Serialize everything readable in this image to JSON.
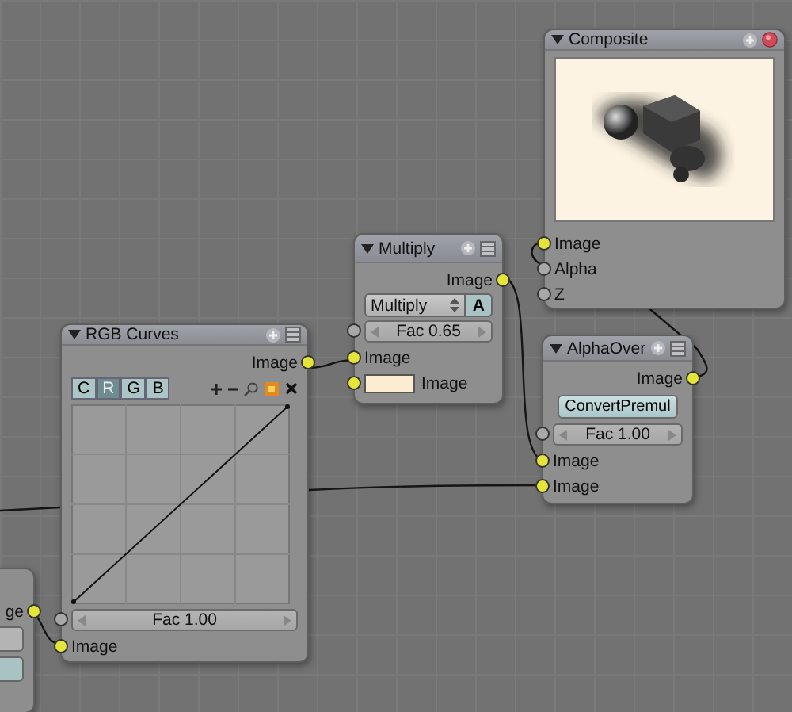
{
  "nodes": [
    {
      "kind": "full",
      "title": "Composite",
      "expanded": true,
      "closable": true,
      "widgets": [
        {
          "kind": "preview"
        }
      ],
      "inputs": [
        {
          "kind": "socket",
          "label": "Image",
          "color": "#e4e43a"
        },
        {
          "kind": "socket",
          "label": "Alpha",
          "color": "#a8a8a8"
        },
        {
          "kind": "socket",
          "label": "Z",
          "color": "#a8a8a8"
        }
      ]
    },
    {
      "kind": "full",
      "title": "Multiply",
      "expanded": true,
      "closable": false,
      "outputs": [
        {
          "kind": "socket",
          "label": "Image",
          "color": "#e4e43a"
        }
      ],
      "widgets": [
        {
          "kind": "dropdown",
          "value": "Multiply",
          "toggle": "A"
        }
      ],
      "inputs": [
        {
          "kind": "value",
          "label": "Fac 0.65",
          "color": "#a8a8a8"
        },
        {
          "kind": "socket",
          "label": "Image",
          "color": "#e4e43a"
        },
        {
          "kind": "color",
          "label": "Image",
          "swatch": {
            "color": "#fcecd0"
          },
          "color": "#e4e43a"
        }
      ]
    },
    {
      "kind": "full",
      "title": "AlphaOver",
      "expanded": true,
      "closable": false,
      "outputs": [
        {
          "kind": "socket",
          "label": "Image",
          "color": "#e4e43a"
        }
      ],
      "widgets": [
        {
          "kind": "button",
          "label": "ConvertPremul"
        }
      ],
      "inputs": [
        {
          "kind": "value",
          "label": "Fac 1.00",
          "color": "#a8a8a8"
        },
        {
          "kind": "socket",
          "label": "Image",
          "color": "#e4e43a"
        },
        {
          "kind": "socket",
          "label": "Image",
          "color": "#e4e43a"
        }
      ]
    },
    {
      "kind": "full",
      "title": "RGB Curves",
      "expanded": true,
      "closable": false,
      "outputs": [
        {
          "kind": "socket",
          "label": "Image",
          "color": "#e4e43a"
        }
      ],
      "widgets": [
        {
          "kind": "channels",
          "items": [
            {
              "label": "C",
              "selected": false
            },
            {
              "label": "R",
              "selected": true
            },
            {
              "label": "G",
              "selected": false
            },
            {
              "label": "B",
              "selected": false
            }
          ]
        },
        {
          "kind": "curve"
        }
      ],
      "inputs": [
        {
          "kind": "value",
          "label": "Fac 1.00",
          "color": "#a8a8a8"
        },
        {
          "kind": "socket",
          "label": "Image",
          "color": "#e4e43a"
        }
      ]
    },
    {
      "kind": "partial",
      "outputs": [
        {
          "kind": "socket",
          "label": "ge",
          "color": "#e4e43a"
        }
      ]
    }
  ]
}
